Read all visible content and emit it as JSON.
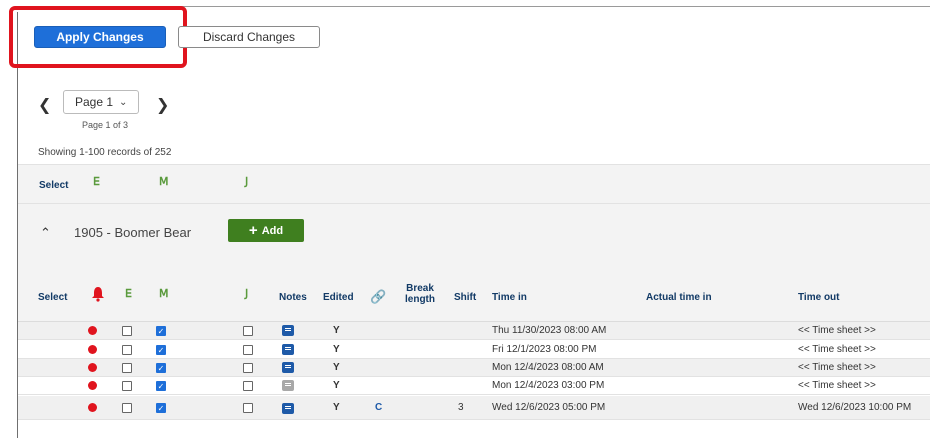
{
  "toolbar": {
    "apply_label": "Apply Changes",
    "discard_label": "Discard Changes"
  },
  "pager": {
    "current": "Page 1",
    "caption": "Page 1 of 3",
    "records": "Showing 1-100 records of 252"
  },
  "select_bar": {
    "label": "Select"
  },
  "group": {
    "title": "1905 - Boomer Bear",
    "add_label": "Add"
  },
  "columns": {
    "select": "Select",
    "notes": "Notes",
    "edited": "Edited",
    "break_length_1": "Break",
    "break_length_2": "length",
    "shift": "Shift",
    "time_in": "Time in",
    "actual_time_in": "Actual time in",
    "time_out": "Time out"
  },
  "rows": [
    {
      "checkbox_e": false,
      "checkbox_m": true,
      "checkbox_sub": false,
      "note_gray": false,
      "edited": "Y",
      "link": "",
      "shift": "",
      "time_in": "Thu 11/30/2023 08:00 AM",
      "time_out": "<< Time sheet >>"
    },
    {
      "checkbox_e": false,
      "checkbox_m": true,
      "checkbox_sub": false,
      "note_gray": false,
      "edited": "Y",
      "link": "",
      "shift": "",
      "time_in": "Fri 12/1/2023 08:00 PM",
      "time_out": "<< Time sheet >>"
    },
    {
      "checkbox_e": false,
      "checkbox_m": true,
      "checkbox_sub": false,
      "note_gray": false,
      "edited": "Y",
      "link": "",
      "shift": "",
      "time_in": "Mon 12/4/2023 08:00 AM",
      "time_out": "<< Time sheet >>"
    },
    {
      "checkbox_e": false,
      "checkbox_m": true,
      "checkbox_sub": false,
      "note_gray": true,
      "edited": "Y",
      "link": "",
      "shift": "",
      "time_in": "Mon 12/4/2023 03:00 PM",
      "time_out": "<< Time sheet >>"
    },
    {
      "checkbox_e": false,
      "checkbox_m": true,
      "checkbox_sub": false,
      "note_gray": false,
      "edited": "Y",
      "link": "C",
      "shift": "3",
      "time_in": "Wed 12/6/2023 05:00 PM",
      "time_out": "Wed 12/6/2023 10:00 PM"
    }
  ],
  "colors": {
    "accent": "#1e6fd9",
    "add_green": "#3f7f1f",
    "alert_red": "#e0141e",
    "highlight": "#e0141e",
    "header_text": "#123a66"
  },
  "icons": [
    "chevron-left-icon",
    "chevron-right-icon",
    "chevron-down-icon",
    "chevron-up-icon",
    "bell-icon",
    "note-icon",
    "link-icon",
    "plus-icon"
  ]
}
